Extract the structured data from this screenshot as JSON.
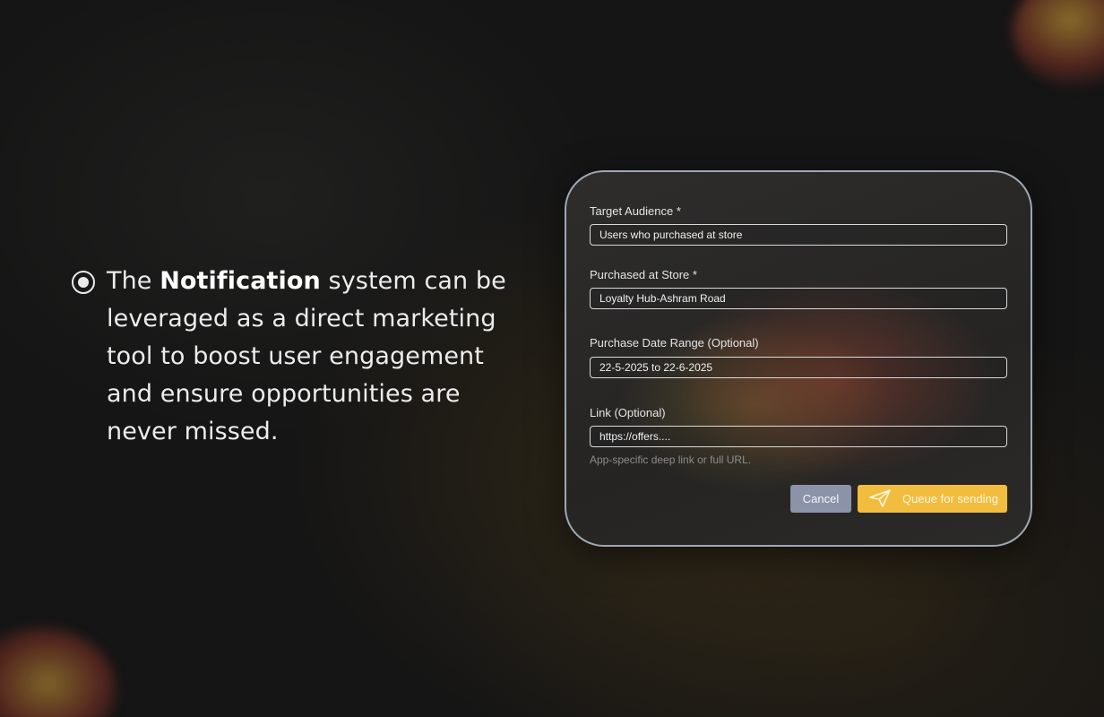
{
  "bullet": {
    "text_before": "The ",
    "text_bold": "Notification",
    "text_after": " system can be leveraged as a direct marketing tool to boost user engagement and ensure opportunities are never missed."
  },
  "form": {
    "target_audience": {
      "label": "Target Audience *",
      "value": "Users who purchased at store"
    },
    "purchased_at_store": {
      "label": "Purchased at Store *",
      "value": "Loyalty Hub-Ashram Road"
    },
    "purchase_date_range": {
      "label": "Purchase Date Range (Optional)",
      "value": "22-5-2025 to 22-6-2025"
    },
    "link": {
      "label": "Link (Optional)",
      "value": "https://offers....",
      "help": "App-specific deep link or full URL."
    },
    "cancel_label": "Cancel",
    "queue_label": "Queue for sending",
    "queue_icon": "paper-plane-icon"
  },
  "colors": {
    "accent": "#f2bd3f",
    "cancel": "#8b93a9",
    "background": "#151515"
  }
}
